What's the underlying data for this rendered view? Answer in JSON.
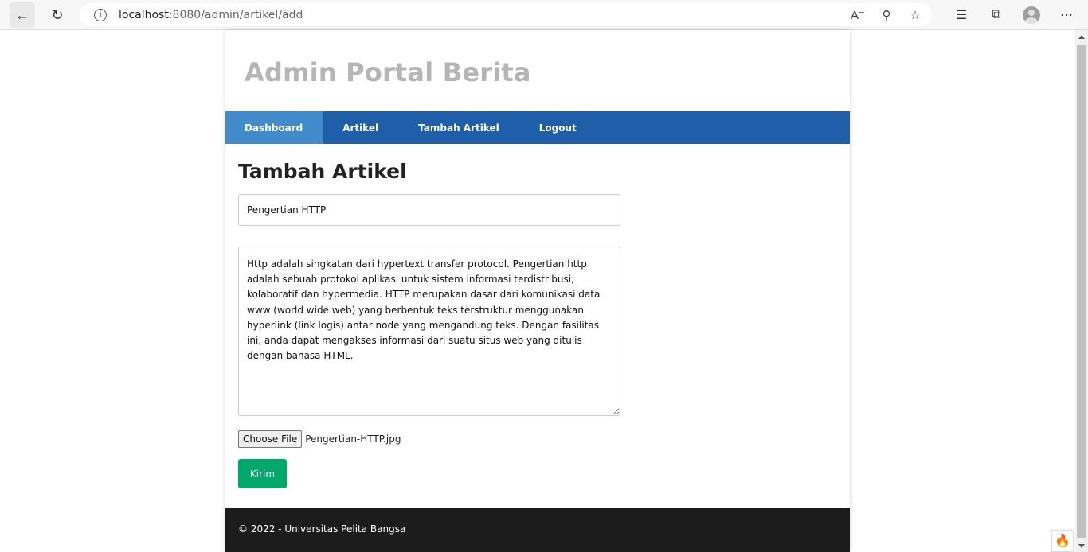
{
  "browser": {
    "url_host": "localhost",
    "url_path": ":8080/admin/artikel/add"
  },
  "site": {
    "title": "Admin Portal Berita"
  },
  "nav": {
    "items": [
      {
        "label": "Dashboard",
        "active": true
      },
      {
        "label": "Artikel",
        "active": false
      },
      {
        "label": "Tambah Artikel",
        "active": false
      },
      {
        "label": "Logout",
        "active": false
      }
    ]
  },
  "form": {
    "heading": "Tambah Artikel",
    "title_value": "Pengertian HTTP",
    "content_value": "Http adalah singkatan dari hypertext transfer protocol. Pengertian http adalah sebuah protokol aplikasi untuk sistem informasi terdistribusi, kolaboratif dan hypermedia. HTTP merupakan dasar dari komunikasi data www (world wide web) yang berbentuk teks terstruktur menggunakan hyperlink (link logis) antar node yang mengandung teks. Dengan fasilitas ini, anda dapat mengakses informasi dari suatu situs web yang ditulis dengan bahasa HTML.",
    "file_button": "Choose File",
    "file_name": "Pengertian-HTTP.jpg",
    "submit_label": "Kirim"
  },
  "footer": {
    "text": "© 2022 - Universitas Pelita Bangsa"
  },
  "colors": {
    "navbar": "#1f5faa",
    "nav_active": "#428bca",
    "submit": "#00a86b",
    "footer": "#1c1c1c",
    "title": "#b5b5b5"
  },
  "icons": {
    "back": "arrow-left-icon",
    "reload": "reload-icon",
    "info": "info-icon",
    "read_aloud": "read-aloud-icon",
    "zoom": "zoom-out-icon",
    "favorite": "add-favorite-icon",
    "favorites": "favorites-icon",
    "collections": "collections-icon",
    "profile": "profile-avatar-icon",
    "menu": "more-menu-icon"
  }
}
